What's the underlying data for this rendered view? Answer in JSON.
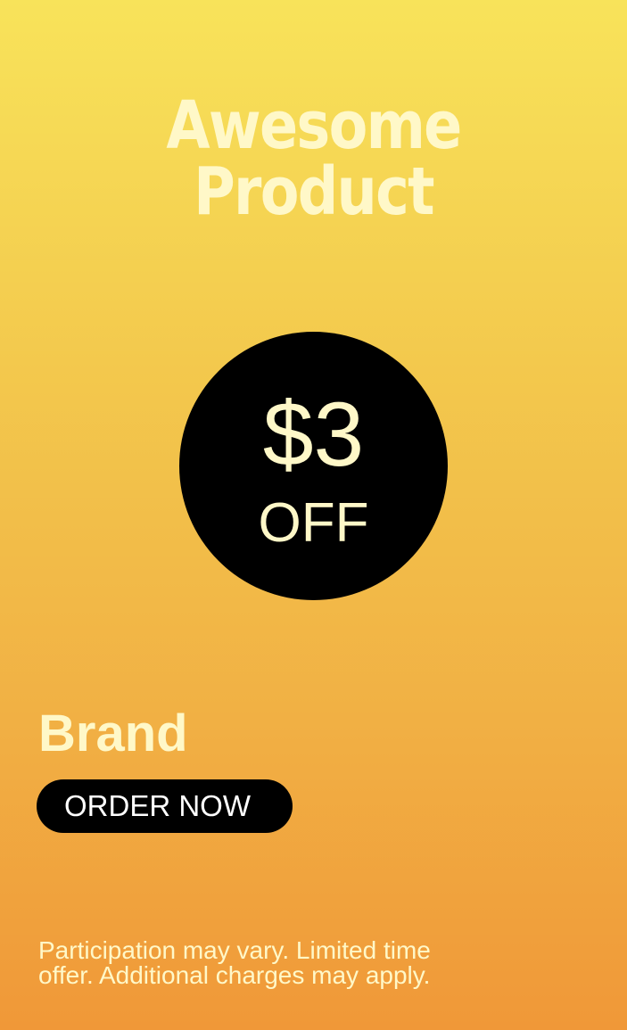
{
  "title": {
    "line1": "Awesome",
    "line2": "Product"
  },
  "offer": {
    "amount": "$3",
    "label": "OFF"
  },
  "brand": "Brand",
  "cta": {
    "label": "ORDER NOW"
  },
  "disclaimer": {
    "line1": "Participation may vary. Limited time",
    "line2": "offer. Additional charges may apply."
  },
  "colors": {
    "gradient_top": "#f8e35a",
    "gradient_bottom": "#f09838",
    "text_cream": "#fff8c8",
    "badge": "#000000",
    "button": "#000000",
    "button_text": "#ffffff"
  }
}
